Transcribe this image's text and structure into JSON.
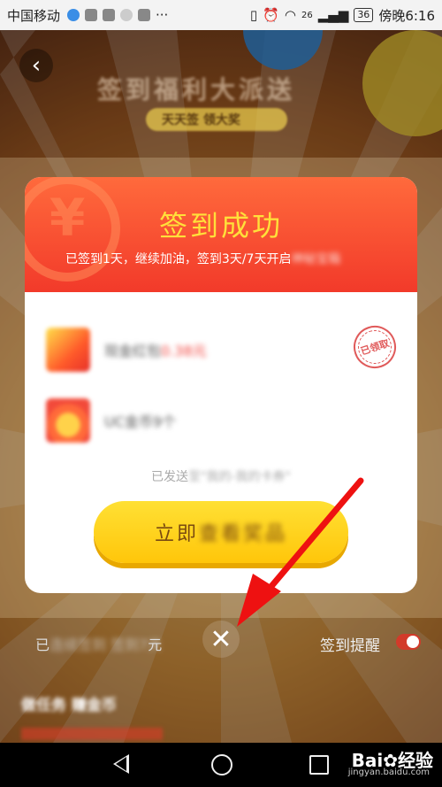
{
  "status_bar": {
    "carrier": "中国移动",
    "dots": "···",
    "network": "26",
    "battery": "36",
    "time": "傍晚6:16"
  },
  "header": {
    "back_glyph": "‹",
    "title": "签到福利大派送",
    "subtitle": "天天签 领大奖"
  },
  "dialog": {
    "title": "签到成功",
    "subtitle_visible": "已签到1天，继续加油，签到3天/7天开启",
    "subtitle_blurred": "神秘宝箱",
    "rewards": [
      {
        "label": "现金红包",
        "amount": "0.38元",
        "status": "已领取"
      },
      {
        "label": "UC金币9个"
      }
    ],
    "sent_note_visible": "已发送",
    "sent_note_blurred": "至\"我的-我的卡券\"",
    "button_visible": "立即",
    "button_blurred": "查看奖品",
    "close_glyph": "✕"
  },
  "bottom": {
    "left_visible": "已",
    "left_blurred": "连续签到  签到7天",
    "left_tail": "元",
    "remind_label": "签到提醒",
    "remind_on": true
  },
  "tasks": {
    "title": "做任务 赚金币"
  },
  "watermark": {
    "text": "Bai✿经验",
    "url": "jingyan.baidu.com"
  },
  "colors": {
    "header_red": "#f23a2a",
    "title_yellow": "#ffe03a",
    "button_yellow": "#ffc60a",
    "arrow_red": "#ee1111"
  }
}
